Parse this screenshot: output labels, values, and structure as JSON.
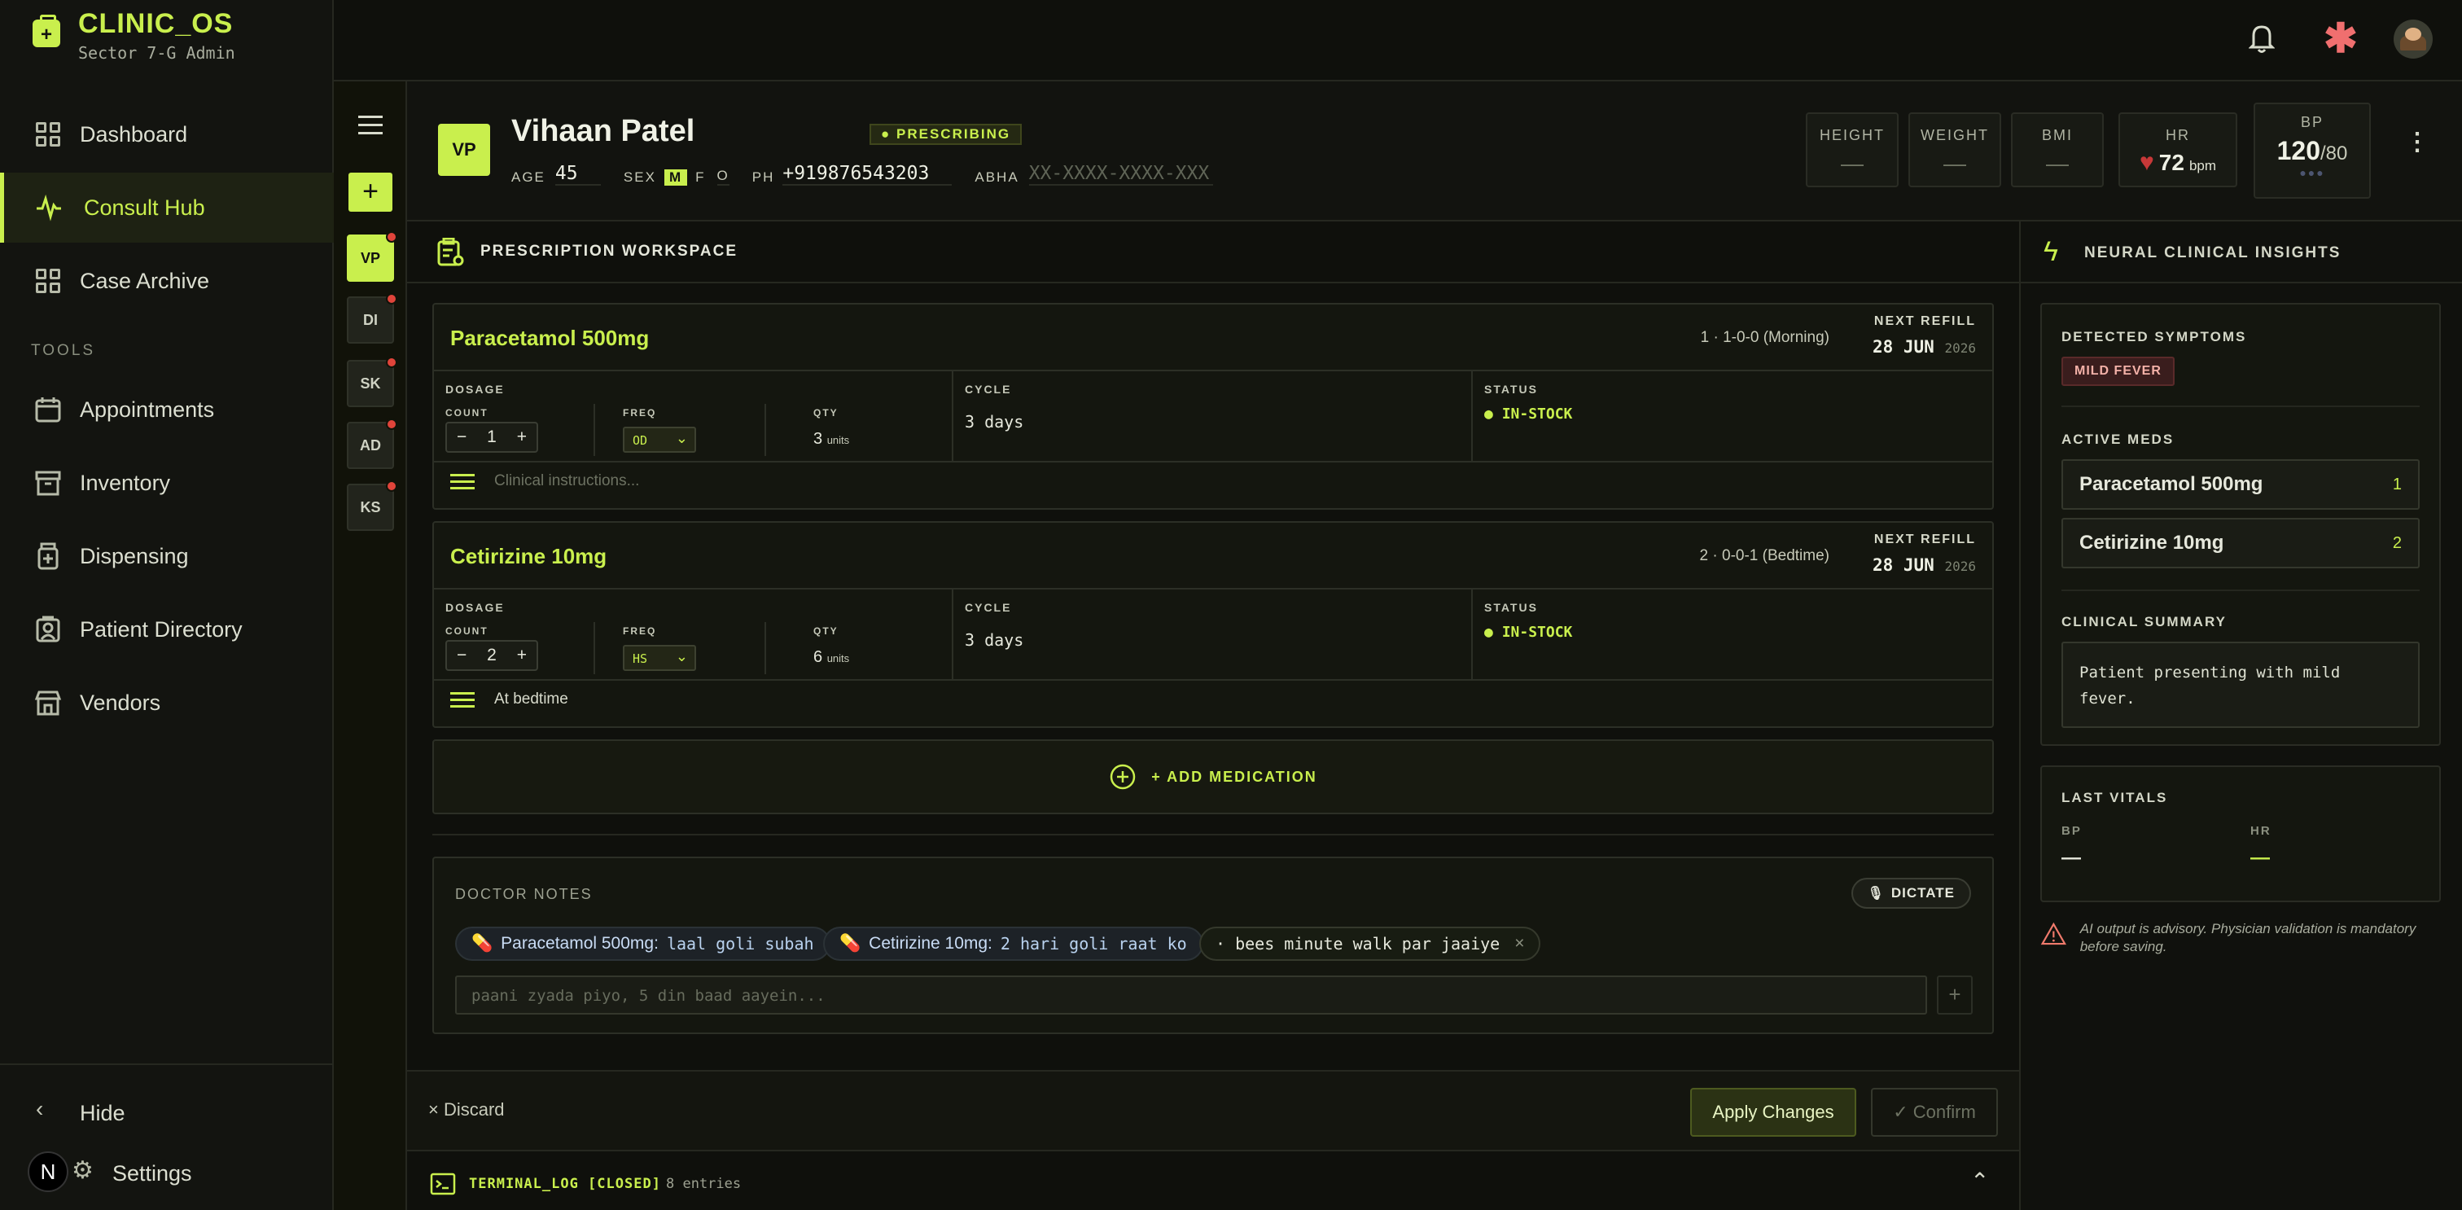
{
  "brand": {
    "name": "CLINIC_OS",
    "subtitle": "Sector 7-G Admin"
  },
  "nav": [
    {
      "label": "Dashboard",
      "icon": "grid-icon"
    },
    {
      "label": "Consult Hub",
      "icon": "pulse-icon",
      "active": true
    },
    {
      "label": "Case Archive",
      "icon": "grid-icon"
    }
  ],
  "tools_label": "TOOLS",
  "tools": [
    {
      "label": "Appointments",
      "icon": "calendar-icon"
    },
    {
      "label": "Inventory",
      "icon": "archive-icon"
    },
    {
      "label": "Dispensing",
      "icon": "medicine-icon"
    },
    {
      "label": "Patient Directory",
      "icon": "contact-icon"
    },
    {
      "label": "Vendors",
      "icon": "store-icon"
    }
  ],
  "sidebar_footer": {
    "hide": "Hide",
    "settings": "Settings",
    "avatar_letter": "N"
  },
  "rail": [
    "VP",
    "DI",
    "SK",
    "AD",
    "KS"
  ],
  "patient": {
    "initials": "VP",
    "name": "Vihaan Patel",
    "status": "PRESCRIBING",
    "age_label": "AGE",
    "age": "45",
    "sex_label": "SEX",
    "sex_options": [
      "M",
      "F",
      "O"
    ],
    "phone_label": "PH",
    "phone": "+919876543203",
    "abha_label": "ABHA",
    "abha_placeholder": "XX-XXXX-XXXX-XXX"
  },
  "vitals": {
    "height": {
      "label": "HEIGHT",
      "value": "—"
    },
    "weight": {
      "label": "WEIGHT",
      "value": "—"
    },
    "bmi": {
      "label": "BMI",
      "value": "—"
    },
    "hr": {
      "label": "HR",
      "value": "72",
      "unit": "bpm"
    },
    "bp": {
      "label": "BP",
      "sys": "120",
      "dia": "/80"
    }
  },
  "workspace_title": "PRESCRIPTION WORKSPACE",
  "labels": {
    "next_refill": "NEXT REFILL",
    "dosage": "DOSAGE",
    "count": "COUNT",
    "freq": "FREQ",
    "qty": "QTY",
    "cycle": "CYCLE",
    "status": "STATUS",
    "units": "units"
  },
  "meds": [
    {
      "name": "Paracetamol 500mg",
      "index": "1",
      "schedule": "1-0-0 (Morning)",
      "refill_day": "28 JUN",
      "refill_year": "2026",
      "count": "1",
      "freq": "OD",
      "qty": "3",
      "cycle": "3 days",
      "status": "IN-STOCK",
      "instructions": "",
      "instructions_placeholder": "Clinical instructions..."
    },
    {
      "name": "Cetirizine 10mg",
      "index": "2",
      "schedule": "0-0-1 (Bedtime)",
      "refill_day": "28 JUN",
      "refill_year": "2026",
      "count": "2",
      "freq": "HS",
      "qty": "6",
      "cycle": "3 days",
      "status": "IN-STOCK",
      "instructions": "At bedtime",
      "instructions_placeholder": ""
    }
  ],
  "add_med": "+ ADD MEDICATION",
  "notes": {
    "title": "DOCTOR NOTES",
    "dictate": "DICTATE",
    "chips": [
      {
        "med": "Paracetamol 500mg:",
        "text": "laal goli subah"
      },
      {
        "med": "Cetirizine 10mg:",
        "text": "2 hari goli raat ko"
      }
    ],
    "free_chip": "· bees minute walk par jaaiye",
    "input_placeholder": "paani zyada piyo, 5 din baad aayein..."
  },
  "actions": {
    "discard": "Discard",
    "apply": "Apply Changes",
    "confirm": "✓ Confirm"
  },
  "terminal": {
    "label": "TERMINAL_LOG [CLOSED]",
    "count": "8 entries"
  },
  "insights": {
    "title": "NEURAL CLINICAL INSIGHTS",
    "symptoms_label": "DETECTED SYMPTOMS",
    "symptom": "MILD FEVER",
    "active_label": "ACTIVE MEDS",
    "active": [
      {
        "name": "Paracetamol 500mg",
        "n": "1"
      },
      {
        "name": "Cetirizine 10mg",
        "n": "2"
      }
    ],
    "summary_label": "CLINICAL SUMMARY",
    "summary": "Patient presenting with mild fever.",
    "last_vitals": "LAST VITALS",
    "bp_label": "BP",
    "bp_val": "—",
    "hr_label": "HR",
    "hr_val": "—",
    "disclaimer": "AI output is advisory. Physician validation is mandatory before saving."
  },
  "colors": {
    "accent": "#c9ef4d",
    "alert": "#e0443a",
    "bg": "#0e0f0b"
  }
}
